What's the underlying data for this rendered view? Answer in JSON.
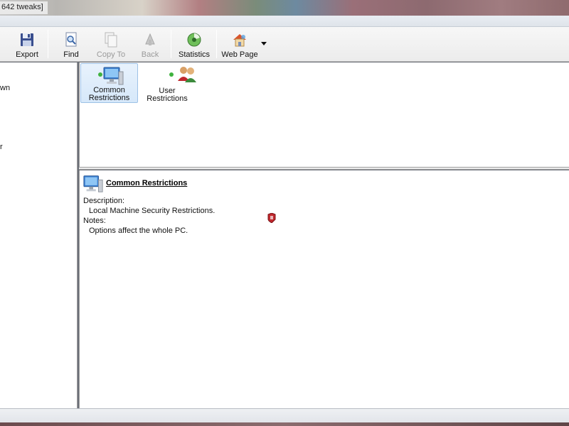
{
  "window": {
    "title_fragment": "642 tweaks]"
  },
  "toolbar": {
    "buttons": [
      {
        "label": "Export",
        "icon": "floppy-disk-icon",
        "enabled": true
      },
      {
        "label": "Find",
        "icon": "find-document-icon",
        "enabled": true
      },
      {
        "label": "Copy To",
        "icon": "copy-icon",
        "enabled": false
      },
      {
        "label": "Back",
        "icon": "back-arrow-icon",
        "enabled": false
      },
      {
        "label": "Statistics",
        "icon": "statistics-icon",
        "enabled": true
      },
      {
        "label": "Web Page",
        "icon": "home-icon",
        "enabled": true
      }
    ]
  },
  "tree": {
    "fragments": [
      "wn",
      "r"
    ]
  },
  "categories": [
    {
      "label_line1": "Common",
      "label_line2": "Restrictions",
      "selected": true,
      "icon": "computer-icon"
    },
    {
      "label_line1": "User",
      "label_line2": "Restrictions",
      "selected": false,
      "icon": "users-icon"
    }
  ],
  "detail": {
    "title": "Common Restrictions",
    "description_label": "Description:",
    "description_value": "Local Machine Security Restrictions.",
    "notes_label": "Notes:",
    "notes_value": "Options affect the whole PC."
  },
  "colors": {
    "accent_green": "#3fb23f",
    "selection_bg": "#d6e8fa",
    "shield_red": "#c0282d"
  }
}
